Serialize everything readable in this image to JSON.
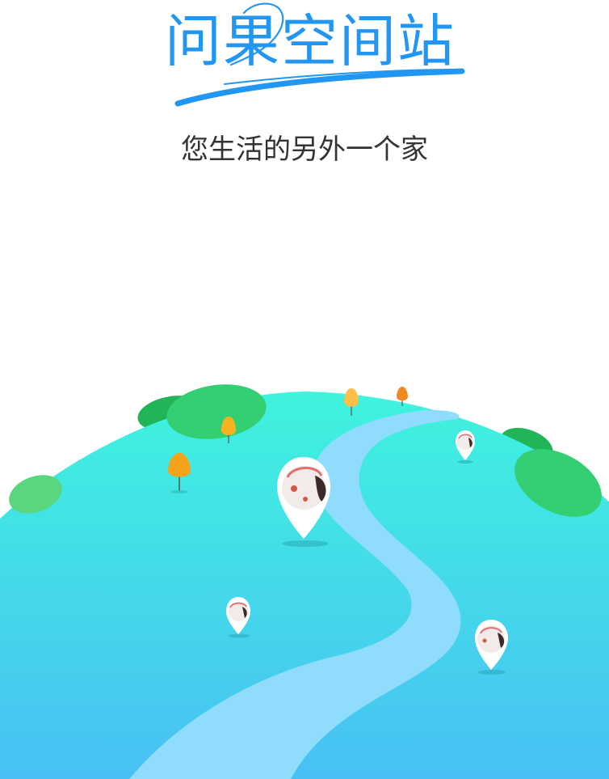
{
  "app": {
    "title": "问果空间站",
    "tagline": "您生活的另外一个家"
  },
  "colors": {
    "brand_blue": "#2196f3",
    "planet_top": "#3ff0df",
    "planet_bottom": "#48c2f4",
    "river": "#8fdcfd",
    "leaf_dark": "#22b557",
    "leaf_light": "#34cf73",
    "tree_orange": "#f7a21b",
    "tree_yellow": "#fcc04a"
  },
  "pins": [
    {
      "name": "map-pin-center",
      "icon": "location-pin-avatar"
    },
    {
      "name": "map-pin-top-right",
      "icon": "location-pin-avatar"
    },
    {
      "name": "map-pin-bottom-left",
      "icon": "location-pin-avatar"
    },
    {
      "name": "map-pin-bottom-right",
      "icon": "location-pin-avatar"
    }
  ]
}
